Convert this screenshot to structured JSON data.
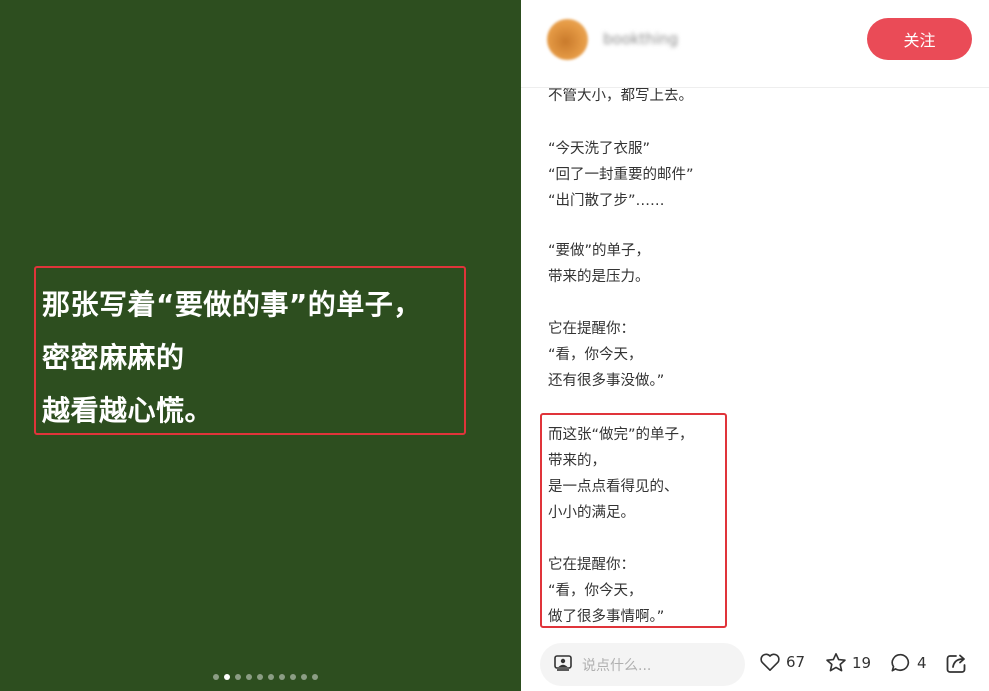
{
  "image": {
    "overlay_lines": [
      "那张写着“要做的事”的单子，",
      "密密麻麻的",
      "越看越心慌。"
    ],
    "background_color": "#2d4e1f",
    "carousel": {
      "total": 10,
      "active_index": 1
    }
  },
  "header": {
    "username": "bookthing",
    "follow_label": "关注",
    "accent_color": "#ea4b57"
  },
  "post": {
    "lines": [
      "不管大小，都写上去。",
      "“今天洗了衣服”",
      "“回了一封重要的邮件”",
      "“出门散了步”……",
      "“要做”的单子，",
      "带来的是压力。",
      "它在提醒你：",
      "“看，你今天，",
      "还有很多事没做。”",
      "而这张“做完”的单子，",
      "带来的，",
      "是一点点看得见的、",
      "小小的满足。",
      "它在提醒你：",
      "“看，你今天，",
      "做了很多事情啊。”"
    ]
  },
  "bottom_bar": {
    "comment_placeholder": "说点什么...",
    "likes": "67",
    "favorites": "19",
    "comments": "4",
    "icons": [
      "comment-input-icon",
      "heart-icon",
      "star-icon",
      "comment-icon",
      "share-icon"
    ]
  }
}
